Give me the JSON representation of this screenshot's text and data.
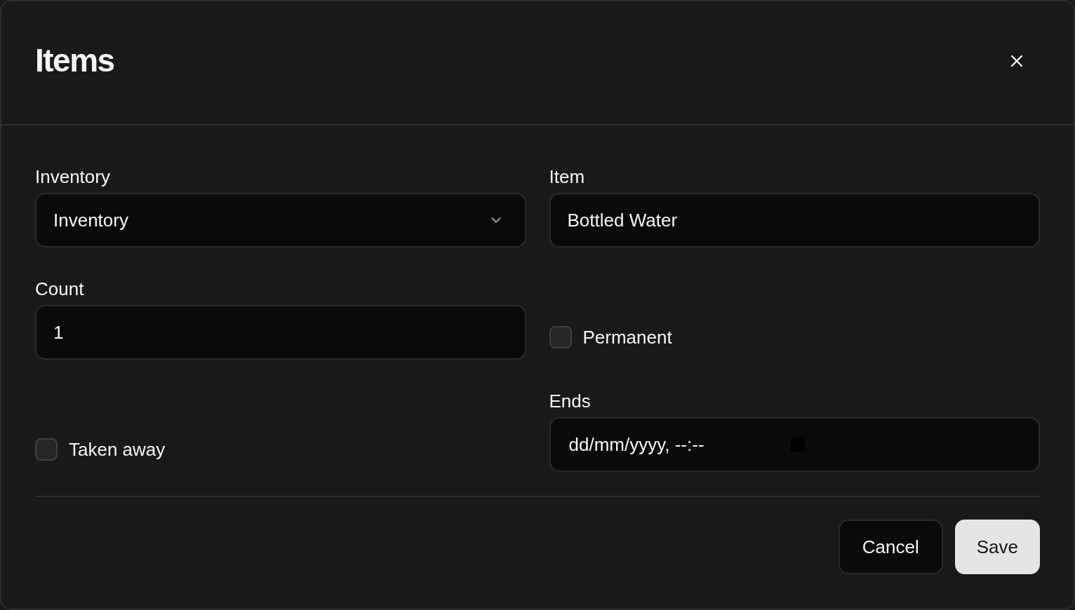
{
  "dialog": {
    "title": "Items"
  },
  "fields": [
    {
      "kind": "select",
      "label": "Inventory",
      "value": "Inventory"
    },
    {
      "kind": "text",
      "label": "Item",
      "value": "Bottled Water"
    },
    {
      "kind": "text",
      "label": "Count",
      "value": "1"
    },
    {
      "kind": "checkbox",
      "label": "Permanent",
      "checked": false
    },
    {
      "kind": "checkbox",
      "label": "Taken away",
      "checked": false
    },
    {
      "kind": "datetime",
      "label": "Ends",
      "placeholder": "dd/mm/yyyy, --:--"
    }
  ],
  "buttons": [
    {
      "kind": "secondary",
      "label": "Cancel"
    },
    {
      "kind": "primary",
      "label": "Save"
    }
  ]
}
